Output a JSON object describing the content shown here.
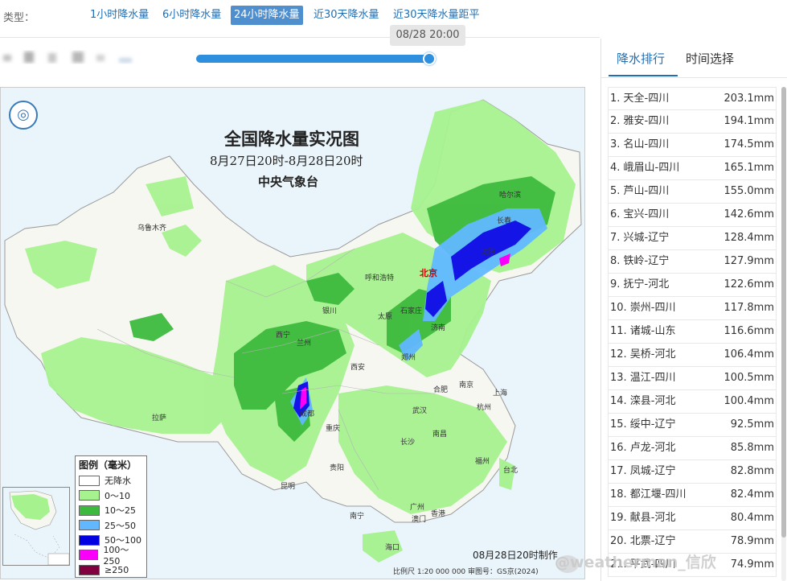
{
  "type_bar": {
    "label": "类型：",
    "options": [
      "1小时降水量",
      "6小时降水量",
      "24小时降水量",
      "近30天降水量",
      "近30天降水量距平"
    ],
    "selected_index": 2
  },
  "timeline": {
    "current_time": "08/28 20:00",
    "progress": 1.0
  },
  "map": {
    "title": "全国降水量实况图",
    "subtitle": "8月27日20时-8月28日20时",
    "issuer": "中央气象台",
    "made_time": "08月28日20时制作",
    "scale_text": "比例尺 1:20 000 000   审图号：GS京(2024)",
    "cities": [
      {
        "name": "北京",
        "capital": true
      },
      {
        "name": "哈尔滨"
      },
      {
        "name": "长春"
      },
      {
        "name": "沈阳"
      },
      {
        "name": "呼和浩特"
      },
      {
        "name": "石家庄"
      },
      {
        "name": "太原"
      },
      {
        "name": "银川"
      },
      {
        "name": "济南"
      },
      {
        "name": "西宁"
      },
      {
        "name": "兰州"
      },
      {
        "name": "郑州"
      },
      {
        "name": "西安"
      },
      {
        "name": "南京"
      },
      {
        "name": "上海"
      },
      {
        "name": "合肥"
      },
      {
        "name": "武汉"
      },
      {
        "name": "杭州"
      },
      {
        "name": "成都"
      },
      {
        "name": "重庆"
      },
      {
        "name": "长沙"
      },
      {
        "name": "南昌"
      },
      {
        "name": "福州"
      },
      {
        "name": "台北"
      },
      {
        "name": "贵阳"
      },
      {
        "name": "昆明"
      },
      {
        "name": "南宁"
      },
      {
        "name": "广州"
      },
      {
        "name": "澳门"
      },
      {
        "name": "香港"
      },
      {
        "name": "海口"
      },
      {
        "name": "拉萨"
      },
      {
        "name": "乌鲁木齐"
      }
    ],
    "legend": {
      "title": "图例（毫米）",
      "items": [
        {
          "label": "无降水",
          "color": "#ffffff"
        },
        {
          "label": "0～10",
          "color": "#a6f28f"
        },
        {
          "label": "10～25",
          "color": "#3dba3d"
        },
        {
          "label": "25～50",
          "color": "#61b8ff"
        },
        {
          "label": "50～100",
          "color": "#0000e1"
        },
        {
          "label": "100～250",
          "color": "#fa00fa"
        },
        {
          "label": "≥250",
          "color": "#800040"
        }
      ]
    }
  },
  "panel": {
    "tabs": [
      "降水排行",
      "时间选择"
    ],
    "active_tab": 0,
    "ranking": [
      {
        "name": "1. 天全-四川",
        "value": "203.1mm"
      },
      {
        "name": "2. 雅安-四川",
        "value": "194.1mm"
      },
      {
        "name": "3. 名山-四川",
        "value": "174.5mm"
      },
      {
        "name": "4. 峨眉山-四川",
        "value": "165.1mm"
      },
      {
        "name": "5. 芦山-四川",
        "value": "155.0mm"
      },
      {
        "name": "6. 宝兴-四川",
        "value": "142.6mm"
      },
      {
        "name": "7. 兴城-辽宁",
        "value": "128.4mm"
      },
      {
        "name": "8. 铁岭-辽宁",
        "value": "127.9mm"
      },
      {
        "name": "9. 抚宁-河北",
        "value": "122.6mm"
      },
      {
        "name": "10. 崇州-四川",
        "value": "117.8mm"
      },
      {
        "name": "11. 诸城-山东",
        "value": "116.6mm"
      },
      {
        "name": "12. 吴桥-河北",
        "value": "106.4mm"
      },
      {
        "name": "13. 温江-四川",
        "value": "100.5mm"
      },
      {
        "name": "14. 滦县-河北",
        "value": "100.4mm"
      },
      {
        "name": "15. 绥中-辽宁",
        "value": "92.5mm"
      },
      {
        "name": "16. 卢龙-河北",
        "value": "85.8mm"
      },
      {
        "name": "17. 凤城-辽宁",
        "value": "82.8mm"
      },
      {
        "name": "18. 都江堰-四川",
        "value": "82.4mm"
      },
      {
        "name": "19. 献县-河北",
        "value": "80.4mm"
      },
      {
        "name": "20. 北票-辽宁",
        "value": "78.9mm"
      },
      {
        "name": "21. 平武-四川",
        "value": "74.9mm"
      }
    ]
  },
  "watermark": "@weatherman_信欣"
}
